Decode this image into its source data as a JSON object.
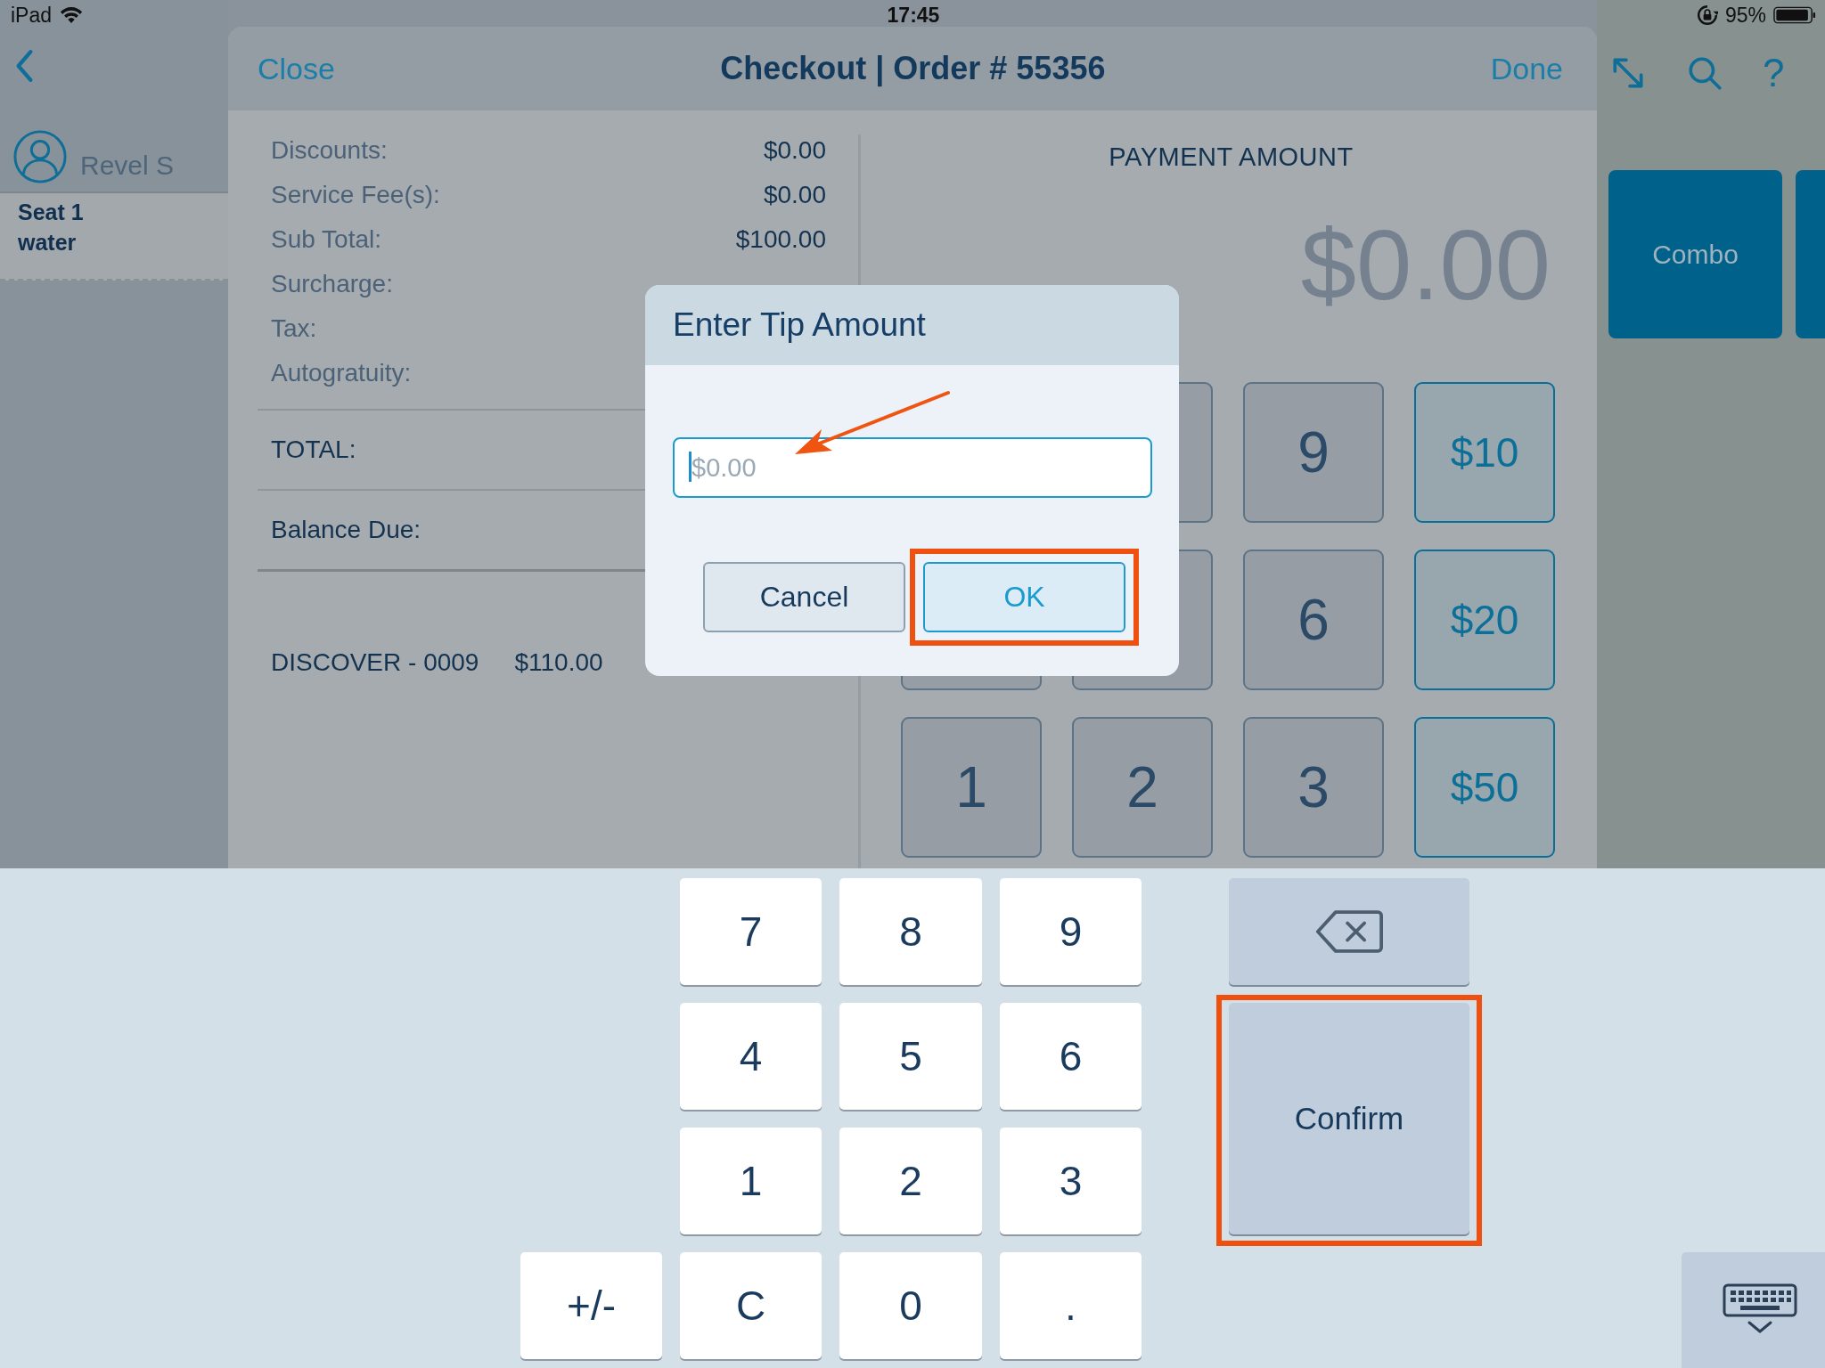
{
  "status_bar": {
    "device": "iPad",
    "time": "17:45",
    "battery": "95%"
  },
  "sidebar": {
    "user": "Revel S",
    "seat": {
      "title": "Seat 1",
      "item": "water"
    }
  },
  "checkout": {
    "close": "Close",
    "title": "Checkout | Order # 55356",
    "done": "Done",
    "summary": [
      {
        "label": "Discounts:",
        "value": "$0.00"
      },
      {
        "label": "Service Fee(s):",
        "value": "$0.00"
      },
      {
        "label": "Sub Total:",
        "value": "$100.00"
      },
      {
        "label": "Surcharge:"
      },
      {
        "label": "Tax:"
      },
      {
        "label": "Autogratuity:"
      }
    ],
    "totals": [
      {
        "label": "TOTAL:"
      },
      {
        "label": "Balance Due:"
      }
    ],
    "payments": [
      {
        "card": "DISCOVER - 0009",
        "amount": "$110.00"
      }
    ],
    "payment_amount": {
      "label": "PAYMENT AMOUNT",
      "value": "$0.00"
    },
    "keypad": [
      [
        {
          "kind": "digit"
        },
        {
          "kind": "digit",
          "label": "9"
        },
        {
          "kind": "amount",
          "label": "$10"
        }
      ],
      [
        {
          "kind": "digit"
        },
        {
          "kind": "digit"
        },
        {
          "kind": "digit",
          "label": "6"
        },
        {
          "kind": "amount",
          "label": "$20"
        }
      ],
      [
        {
          "kind": "digit",
          "label": "1"
        },
        {
          "kind": "digit",
          "label": "2"
        },
        {
          "kind": "digit",
          "label": "3"
        },
        {
          "kind": "amount",
          "label": "$50"
        }
      ]
    ]
  },
  "toolbar": {
    "help": "?"
  },
  "tiles": [
    {
      "kind": "tile",
      "label": "Combo"
    },
    {
      "kind": "tile"
    }
  ],
  "dialog": {
    "title": "Enter Tip Amount",
    "input": {
      "placeholder": "$0.00",
      "focused": true,
      "pointed": true
    },
    "buttons": [
      {
        "label": "Cancel",
        "kind": "secondary",
        "highlighted": false
      },
      {
        "label": "OK",
        "kind": "primary",
        "highlighted": true
      }
    ]
  },
  "keyboard": {
    "rows": [
      [
        "",
        "7",
        "8",
        "9"
      ],
      [
        "",
        "4",
        "5",
        "6"
      ],
      [
        "",
        "1",
        "2",
        "3"
      ],
      [
        "+/-",
        "C",
        "0",
        "."
      ]
    ],
    "confirm": {
      "label": "Confirm",
      "highlighted": true
    }
  }
}
